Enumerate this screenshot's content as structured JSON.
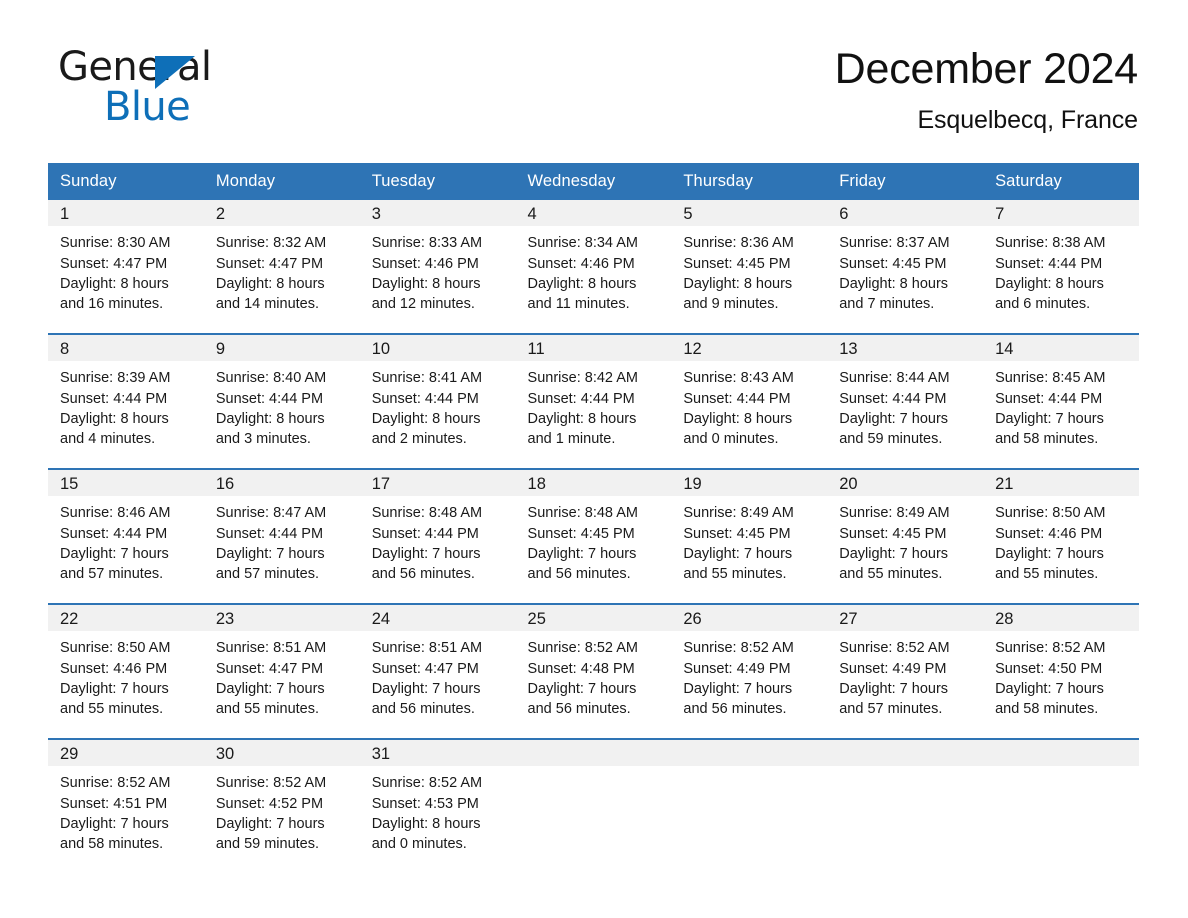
{
  "logo": {
    "word_top": "General",
    "word_bottom": "Blue",
    "triangle_icon": "triangle-icon",
    "brand_blue": "#0E6FB8"
  },
  "header": {
    "title": "December 2024",
    "subtitle": "Esquelbecq, France"
  },
  "theme": {
    "header_blue": "#2E74B5",
    "daynum_gray": "#F1F1F1",
    "text_dark": "#1a1a1a"
  },
  "calendar": {
    "weekdays": [
      "Sunday",
      "Monday",
      "Tuesday",
      "Wednesday",
      "Thursday",
      "Friday",
      "Saturday"
    ],
    "weeks": [
      [
        {
          "day": "1",
          "sunrise": "Sunrise: 8:30 AM",
          "sunset": "Sunset: 4:47 PM",
          "daylight1": "Daylight: 8 hours",
          "daylight2": "and 16 minutes."
        },
        {
          "day": "2",
          "sunrise": "Sunrise: 8:32 AM",
          "sunset": "Sunset: 4:47 PM",
          "daylight1": "Daylight: 8 hours",
          "daylight2": "and 14 minutes."
        },
        {
          "day": "3",
          "sunrise": "Sunrise: 8:33 AM",
          "sunset": "Sunset: 4:46 PM",
          "daylight1": "Daylight: 8 hours",
          "daylight2": "and 12 minutes."
        },
        {
          "day": "4",
          "sunrise": "Sunrise: 8:34 AM",
          "sunset": "Sunset: 4:46 PM",
          "daylight1": "Daylight: 8 hours",
          "daylight2": "and 11 minutes."
        },
        {
          "day": "5",
          "sunrise": "Sunrise: 8:36 AM",
          "sunset": "Sunset: 4:45 PM",
          "daylight1": "Daylight: 8 hours",
          "daylight2": "and 9 minutes."
        },
        {
          "day": "6",
          "sunrise": "Sunrise: 8:37 AM",
          "sunset": "Sunset: 4:45 PM",
          "daylight1": "Daylight: 8 hours",
          "daylight2": "and 7 minutes."
        },
        {
          "day": "7",
          "sunrise": "Sunrise: 8:38 AM",
          "sunset": "Sunset: 4:44 PM",
          "daylight1": "Daylight: 8 hours",
          "daylight2": "and 6 minutes."
        }
      ],
      [
        {
          "day": "8",
          "sunrise": "Sunrise: 8:39 AM",
          "sunset": "Sunset: 4:44 PM",
          "daylight1": "Daylight: 8 hours",
          "daylight2": "and 4 minutes."
        },
        {
          "day": "9",
          "sunrise": "Sunrise: 8:40 AM",
          "sunset": "Sunset: 4:44 PM",
          "daylight1": "Daylight: 8 hours",
          "daylight2": "and 3 minutes."
        },
        {
          "day": "10",
          "sunrise": "Sunrise: 8:41 AM",
          "sunset": "Sunset: 4:44 PM",
          "daylight1": "Daylight: 8 hours",
          "daylight2": "and 2 minutes."
        },
        {
          "day": "11",
          "sunrise": "Sunrise: 8:42 AM",
          "sunset": "Sunset: 4:44 PM",
          "daylight1": "Daylight: 8 hours",
          "daylight2": "and 1 minute."
        },
        {
          "day": "12",
          "sunrise": "Sunrise: 8:43 AM",
          "sunset": "Sunset: 4:44 PM",
          "daylight1": "Daylight: 8 hours",
          "daylight2": "and 0 minutes."
        },
        {
          "day": "13",
          "sunrise": "Sunrise: 8:44 AM",
          "sunset": "Sunset: 4:44 PM",
          "daylight1": "Daylight: 7 hours",
          "daylight2": "and 59 minutes."
        },
        {
          "day": "14",
          "sunrise": "Sunrise: 8:45 AM",
          "sunset": "Sunset: 4:44 PM",
          "daylight1": "Daylight: 7 hours",
          "daylight2": "and 58 minutes."
        }
      ],
      [
        {
          "day": "15",
          "sunrise": "Sunrise: 8:46 AM",
          "sunset": "Sunset: 4:44 PM",
          "daylight1": "Daylight: 7 hours",
          "daylight2": "and 57 minutes."
        },
        {
          "day": "16",
          "sunrise": "Sunrise: 8:47 AM",
          "sunset": "Sunset: 4:44 PM",
          "daylight1": "Daylight: 7 hours",
          "daylight2": "and 57 minutes."
        },
        {
          "day": "17",
          "sunrise": "Sunrise: 8:48 AM",
          "sunset": "Sunset: 4:44 PM",
          "daylight1": "Daylight: 7 hours",
          "daylight2": "and 56 minutes."
        },
        {
          "day": "18",
          "sunrise": "Sunrise: 8:48 AM",
          "sunset": "Sunset: 4:45 PM",
          "daylight1": "Daylight: 7 hours",
          "daylight2": "and 56 minutes."
        },
        {
          "day": "19",
          "sunrise": "Sunrise: 8:49 AM",
          "sunset": "Sunset: 4:45 PM",
          "daylight1": "Daylight: 7 hours",
          "daylight2": "and 55 minutes."
        },
        {
          "day": "20",
          "sunrise": "Sunrise: 8:49 AM",
          "sunset": "Sunset: 4:45 PM",
          "daylight1": "Daylight: 7 hours",
          "daylight2": "and 55 minutes."
        },
        {
          "day": "21",
          "sunrise": "Sunrise: 8:50 AM",
          "sunset": "Sunset: 4:46 PM",
          "daylight1": "Daylight: 7 hours",
          "daylight2": "and 55 minutes."
        }
      ],
      [
        {
          "day": "22",
          "sunrise": "Sunrise: 8:50 AM",
          "sunset": "Sunset: 4:46 PM",
          "daylight1": "Daylight: 7 hours",
          "daylight2": "and 55 minutes."
        },
        {
          "day": "23",
          "sunrise": "Sunrise: 8:51 AM",
          "sunset": "Sunset: 4:47 PM",
          "daylight1": "Daylight: 7 hours",
          "daylight2": "and 55 minutes."
        },
        {
          "day": "24",
          "sunrise": "Sunrise: 8:51 AM",
          "sunset": "Sunset: 4:47 PM",
          "daylight1": "Daylight: 7 hours",
          "daylight2": "and 56 minutes."
        },
        {
          "day": "25",
          "sunrise": "Sunrise: 8:52 AM",
          "sunset": "Sunset: 4:48 PM",
          "daylight1": "Daylight: 7 hours",
          "daylight2": "and 56 minutes."
        },
        {
          "day": "26",
          "sunrise": "Sunrise: 8:52 AM",
          "sunset": "Sunset: 4:49 PM",
          "daylight1": "Daylight: 7 hours",
          "daylight2": "and 56 minutes."
        },
        {
          "day": "27",
          "sunrise": "Sunrise: 8:52 AM",
          "sunset": "Sunset: 4:49 PM",
          "daylight1": "Daylight: 7 hours",
          "daylight2": "and 57 minutes."
        },
        {
          "day": "28",
          "sunrise": "Sunrise: 8:52 AM",
          "sunset": "Sunset: 4:50 PM",
          "daylight1": "Daylight: 7 hours",
          "daylight2": "and 58 minutes."
        }
      ],
      [
        {
          "day": "29",
          "sunrise": "Sunrise: 8:52 AM",
          "sunset": "Sunset: 4:51 PM",
          "daylight1": "Daylight: 7 hours",
          "daylight2": "and 58 minutes."
        },
        {
          "day": "30",
          "sunrise": "Sunrise: 8:52 AM",
          "sunset": "Sunset: 4:52 PM",
          "daylight1": "Daylight: 7 hours",
          "daylight2": "and 59 minutes."
        },
        {
          "day": "31",
          "sunrise": "Sunrise: 8:52 AM",
          "sunset": "Sunset: 4:53 PM",
          "daylight1": "Daylight: 8 hours",
          "daylight2": "and 0 minutes."
        },
        {
          "day": "",
          "sunrise": "",
          "sunset": "",
          "daylight1": "",
          "daylight2": ""
        },
        {
          "day": "",
          "sunrise": "",
          "sunset": "",
          "daylight1": "",
          "daylight2": ""
        },
        {
          "day": "",
          "sunrise": "",
          "sunset": "",
          "daylight1": "",
          "daylight2": ""
        },
        {
          "day": "",
          "sunrise": "",
          "sunset": "",
          "daylight1": "",
          "daylight2": ""
        }
      ]
    ]
  }
}
